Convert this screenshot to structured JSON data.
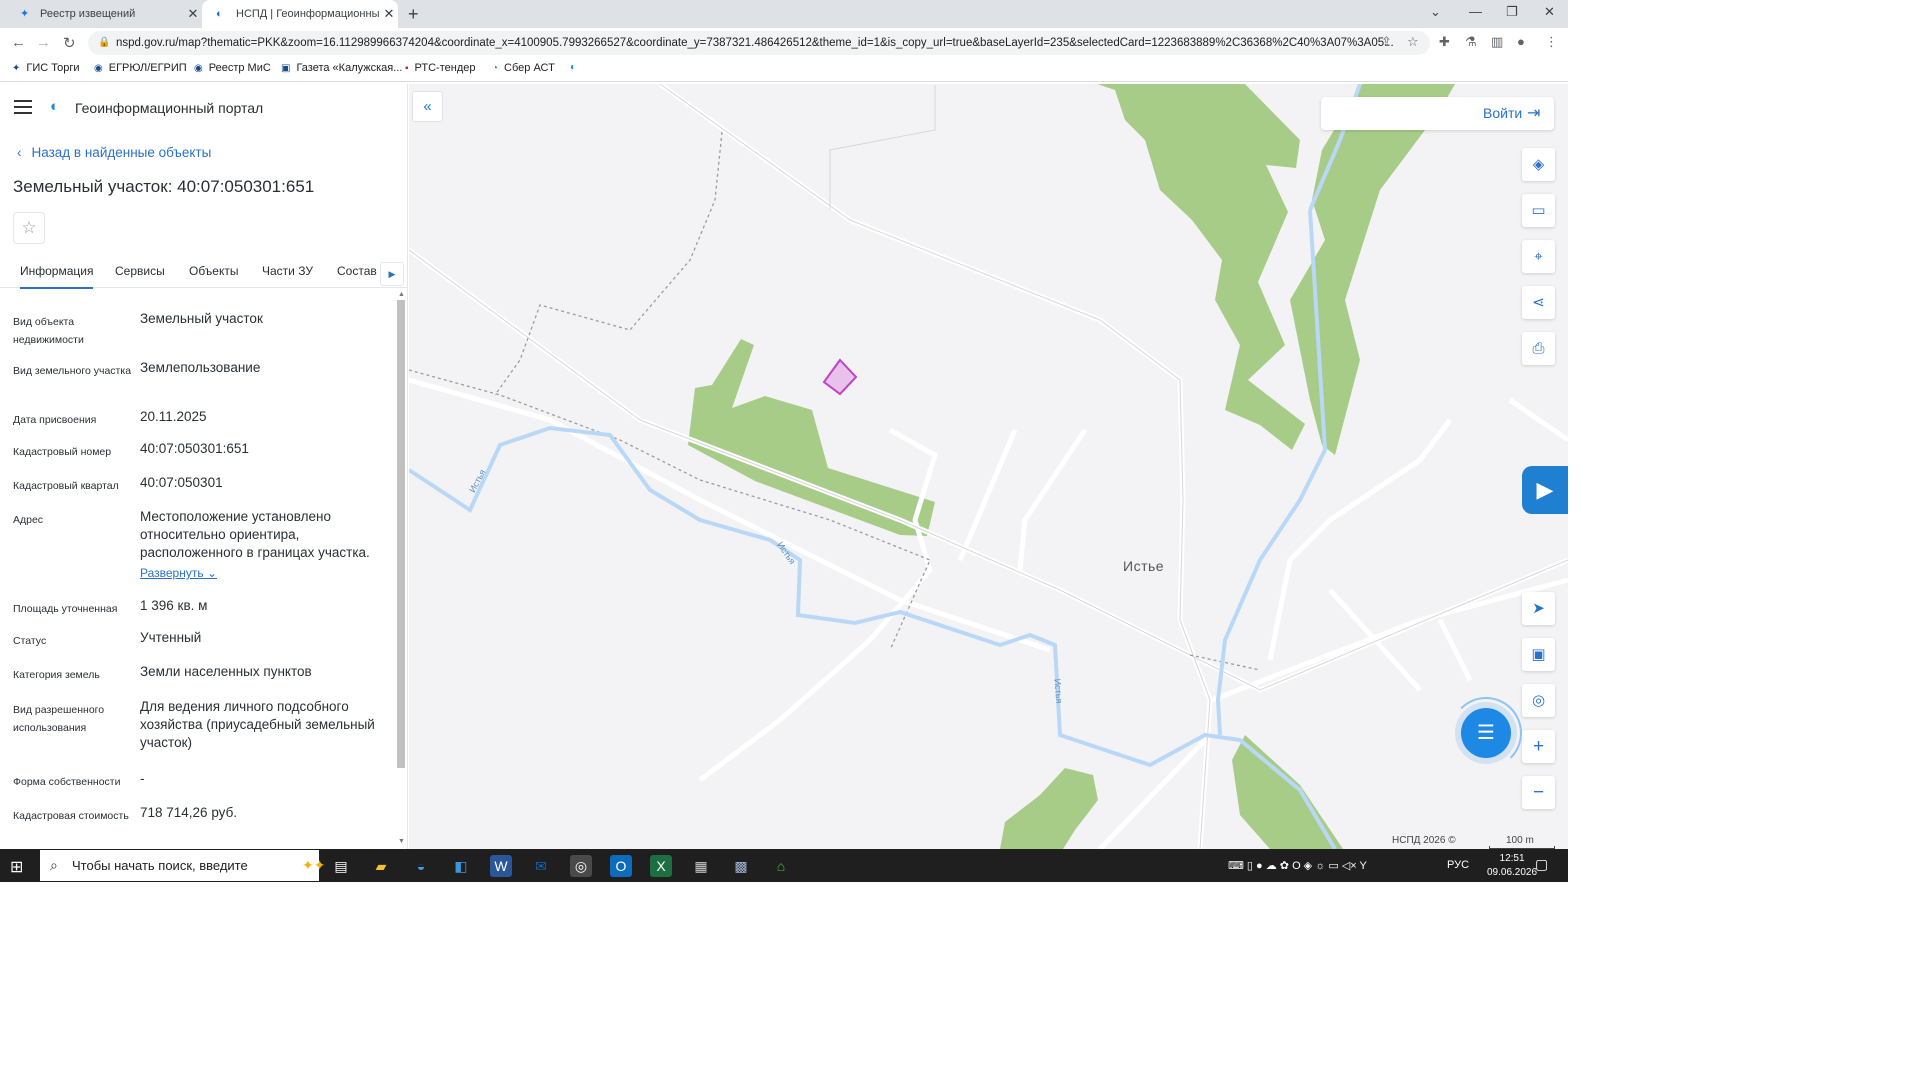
{
  "browser": {
    "tabs": [
      {
        "title": "Реестр извещений",
        "active": false
      },
      {
        "title": "НСПД | Геоинформационный п",
        "active": true
      }
    ],
    "url": "nspd.gov.ru/map?thematic=PKK&zoom=16.112989966374204&coordinate_x=4100905.7993266527&coordinate_y=7387321.486426512&theme_id=1&is_copy_url=true&baseLayerId=235&selectedCard=1223683889%2C36368%2C40%3A07%3A05...",
    "bookmarks": [
      "ГИС Торги",
      "ЕГРЮЛ/ЕГРИП",
      "Реестр МиС",
      "Газета «Калужская...",
      "РТС-тендер",
      "Сбер АСТ"
    ]
  },
  "panel": {
    "portal_title": "Геоинформационный портал",
    "back_label": "Назад в найденные объекты",
    "object_title": "Земельный участок: 40:07:050301:651",
    "tabs": [
      "Информация",
      "Сервисы",
      "Объекты",
      "Части ЗУ",
      "Состав"
    ],
    "expand_label": "Развернуть",
    "fields": [
      {
        "label": "Вид объекта недвижимости",
        "value": "Земельный участок"
      },
      {
        "label": "Вид земельного участка",
        "value": "Землепользование"
      },
      {
        "label": "Дата присвоения",
        "value": "20.11.2025"
      },
      {
        "label": "Кадастровый номер",
        "value": "40:07:050301:651"
      },
      {
        "label": "Кадастровый квартал",
        "value": "40:07:050301"
      },
      {
        "label": "Адрес",
        "value": "Местоположение установлено относительно ориентира, расположенного в границах участка."
      },
      {
        "label": "Площадь уточненная",
        "value": "1 396 кв. м"
      },
      {
        "label": "Статус",
        "value": "Учтенный"
      },
      {
        "label": "Категория земель",
        "value": "Земли населенных пунктов"
      },
      {
        "label": "Вид разрешенного использования",
        "value": "Для ведения личного подсобного хозяйства (приусадебный земельный участок)"
      },
      {
        "label": "Форма собственности",
        "value": "-"
      },
      {
        "label": "Кадастровая стоимость",
        "value": "718 714,26 руб."
      }
    ]
  },
  "map": {
    "login_label": "Войти",
    "village_label": "Истье",
    "river_labels": [
      "Истья",
      "Истья",
      "Истья"
    ],
    "copyright": "НСПД 2026 ©",
    "scale_label": "100 m",
    "colors": {
      "forest": "#a7cc87",
      "river": "#b9d8f7",
      "road": "#ffffff",
      "parcel": "#c040c8"
    }
  },
  "taskbar": {
    "search_placeholder": "Чтобы начать поиск, введите",
    "language": "РУС",
    "time": "12:51",
    "date": "09.06.2026"
  }
}
